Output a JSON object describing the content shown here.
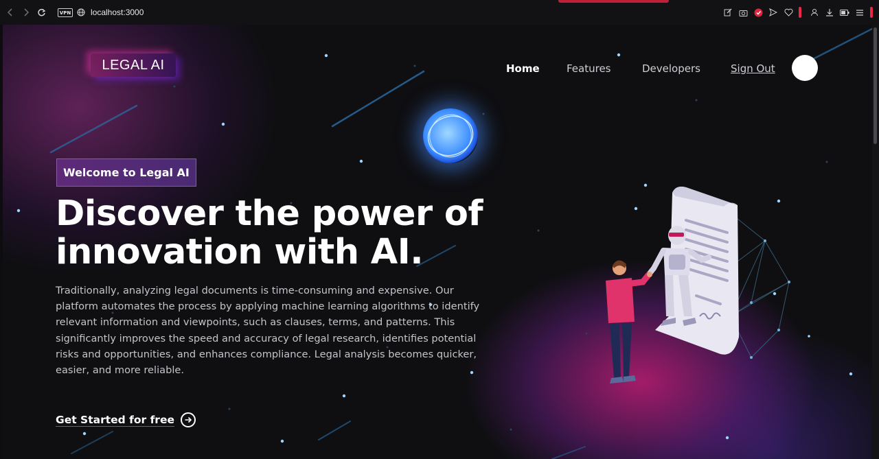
{
  "browser": {
    "url": "localhost:3000",
    "vpn_label": "VPN"
  },
  "colors": {
    "accent_pink": "#c01f3a",
    "badge_purple": "#5e2a78",
    "cta_underline": "#3a66d8"
  },
  "logo": {
    "text": "LEGAL AI"
  },
  "nav": {
    "home": "Home",
    "features": "Features",
    "developers": "Developers",
    "sign_out": "Sign Out"
  },
  "hero": {
    "badge": "Welcome to Legal AI",
    "title_line1": "Discover the power of",
    "title_line2": "innovation with AI.",
    "description": "Traditionally, analyzing legal documents is time-consuming and expensive. Our platform automates the process by applying machine learning algorithms to identify relevant information and viewpoints, such as clauses, terms, and patterns. This significantly improves the speed and accuracy of legal research, identifies potential risks and opportunities, and enhances compliance. Legal analysis becomes quicker, easier, and more reliable.",
    "cta": "Get Started for free"
  },
  "icons": {
    "back": "back-arrow-icon",
    "forward": "forward-arrow-icon",
    "reload": "reload-icon",
    "site": "globe-icon",
    "cta_arrow": "arrow-right-circle-icon"
  }
}
